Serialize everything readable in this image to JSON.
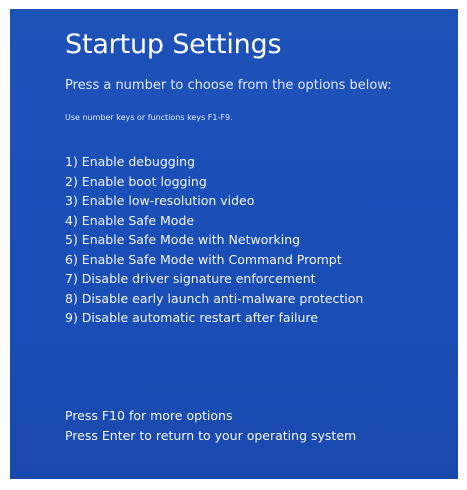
{
  "screen": {
    "title": "Startup Settings",
    "subtitle": "Press a number to choose from the options below:",
    "hint": "Use number keys or functions keys F1-F9.",
    "background_color": "#1c4fb6",
    "text_color": "#ffffff"
  },
  "options": [
    {
      "label": "1) Enable debugging"
    },
    {
      "label": "2) Enable boot logging"
    },
    {
      "label": "3) Enable low-resolution video"
    },
    {
      "label": "4) Enable Safe Mode"
    },
    {
      "label": "5) Enable Safe Mode with Networking"
    },
    {
      "label": "6) Enable Safe Mode with Command Prompt"
    },
    {
      "label": "7) Disable driver signature enforcement"
    },
    {
      "label": "8) Disable early launch anti-malware protection"
    },
    {
      "label": "9) Disable automatic restart after failure"
    }
  ],
  "footer": {
    "more_options": "Press F10 for more options",
    "return": "Press Enter to return to your operating system"
  }
}
